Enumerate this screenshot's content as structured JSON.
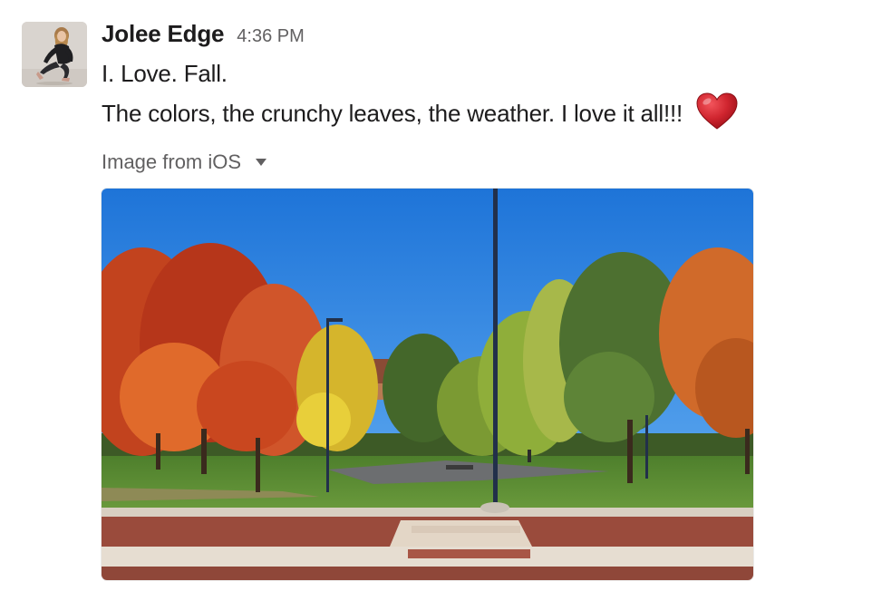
{
  "message": {
    "sender": "Jolee Edge",
    "timestamp": "4:36 PM",
    "lines": [
      "I. Love. Fall.",
      "The colors, the crunchy leaves, the weather. I love it all!!!"
    ],
    "emoji": "heart-icon"
  },
  "attachment": {
    "label": "Image from iOS",
    "menu_icon": "caret-down-icon"
  },
  "colors": {
    "name_text": "#1d1c1d",
    "meta_text": "#616061",
    "heart": "#d0252f",
    "sky": "#2f86e0"
  }
}
